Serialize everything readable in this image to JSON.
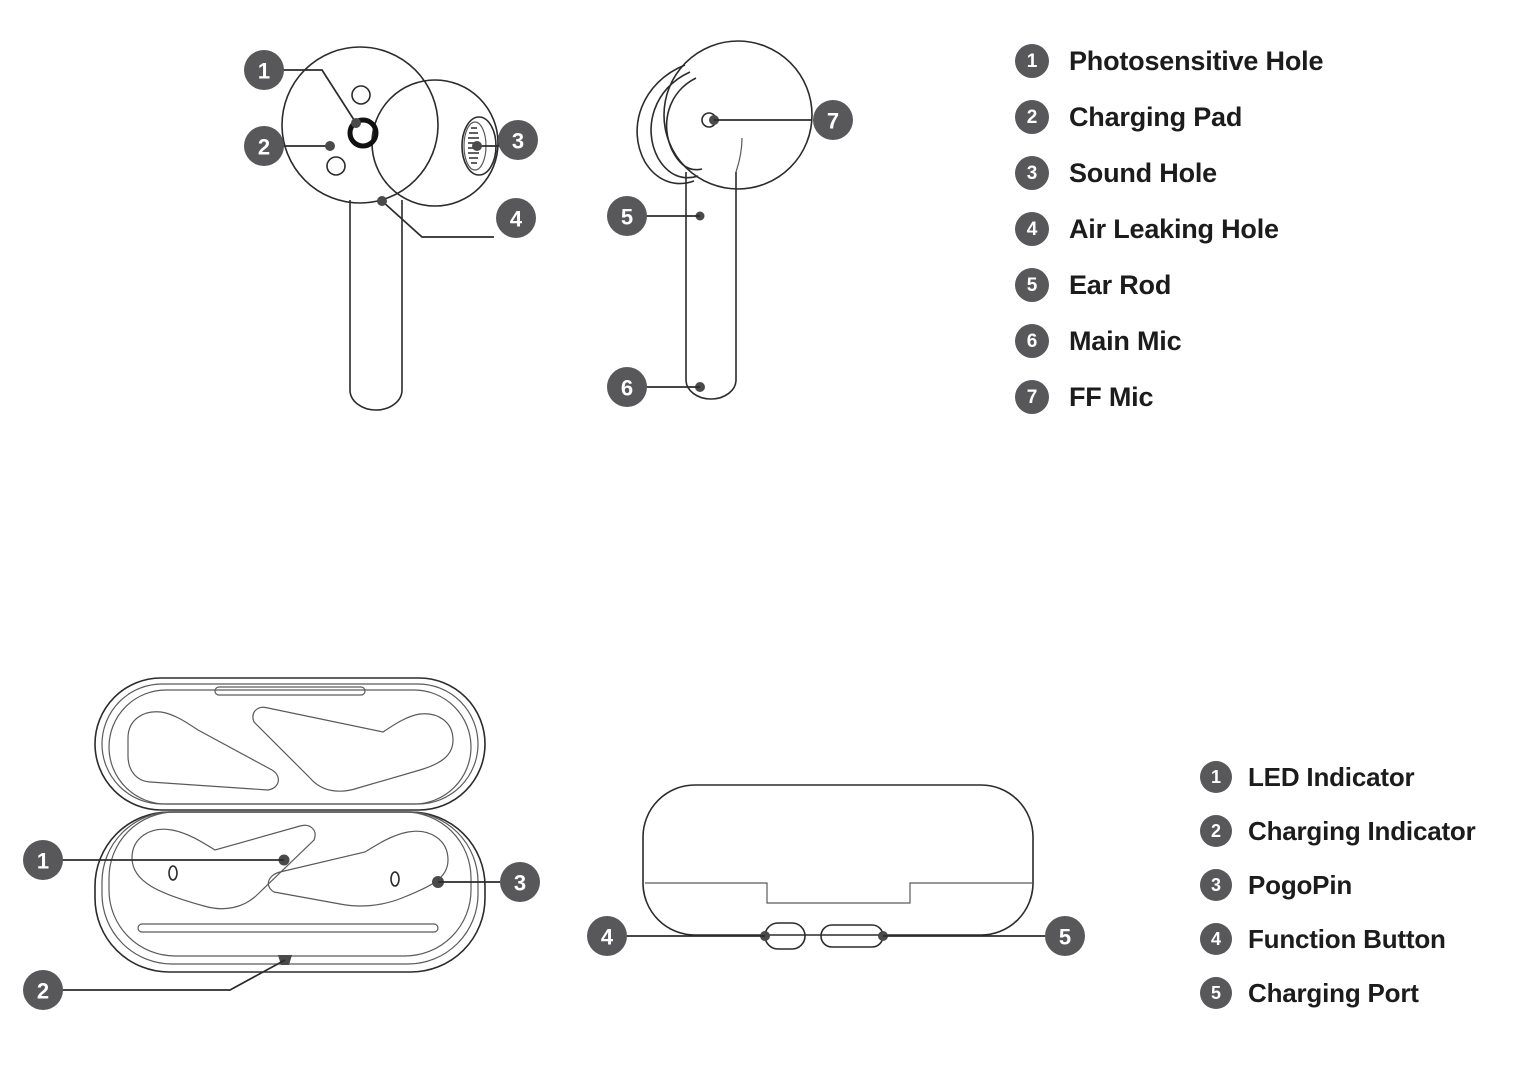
{
  "diagram": {
    "title_present": false,
    "accent_badge_color": "#58585a",
    "line_color": "#2b2b2b",
    "background": "#ffffff"
  },
  "earbud_legend": {
    "items": [
      {
        "number": "1",
        "label": "Photosensitive Hole"
      },
      {
        "number": "2",
        "label": "Charging Pad"
      },
      {
        "number": "3",
        "label": "Sound Hole"
      },
      {
        "number": "4",
        "label": "Air Leaking Hole"
      },
      {
        "number": "5",
        "label": "Ear Rod"
      },
      {
        "number": "6",
        "label": "Main Mic"
      },
      {
        "number": "7",
        "label": "FF Mic"
      }
    ]
  },
  "case_legend": {
    "items": [
      {
        "number": "1",
        "label": "LED Indicator"
      },
      {
        "number": "2",
        "label": "Charging Indicator"
      },
      {
        "number": "3",
        "label": "PogoPin"
      },
      {
        "number": "4",
        "label": "Function Button"
      },
      {
        "number": "5",
        "label": "Charging Port"
      }
    ]
  },
  "earbud_front_view": {
    "callouts": [
      {
        "number": "1",
        "target": "photosensitive-hole"
      },
      {
        "number": "2",
        "target": "charging-pad"
      },
      {
        "number": "3",
        "target": "sound-hole"
      },
      {
        "number": "4",
        "target": "air-leaking-hole"
      }
    ]
  },
  "earbud_side_view": {
    "callouts": [
      {
        "number": "5",
        "target": "ear-rod"
      },
      {
        "number": "6",
        "target": "main-mic"
      },
      {
        "number": "7",
        "target": "ff-mic"
      }
    ]
  },
  "case_open_view": {
    "callouts": [
      {
        "number": "1",
        "target": "led-indicator"
      },
      {
        "number": "2",
        "target": "charging-indicator"
      },
      {
        "number": "3",
        "target": "pogopin"
      }
    ]
  },
  "case_rear_view": {
    "callouts": [
      {
        "number": "4",
        "target": "function-button"
      },
      {
        "number": "5",
        "target": "charging-port"
      }
    ]
  }
}
